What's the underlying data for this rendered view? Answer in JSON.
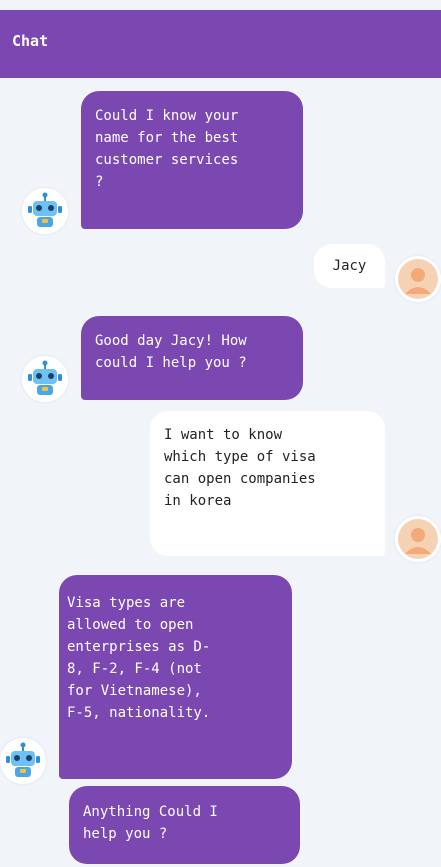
{
  "header": {
    "title": "Chat"
  },
  "messages": [
    {
      "from": "bot",
      "text": "Could I know your\nname for the best\ncustomer services\n?",
      "avatar": "robot-icon"
    },
    {
      "from": "user",
      "text": "Jacy",
      "avatar": "user-avatar-icon"
    },
    {
      "from": "bot",
      "text": "Good day Jacy! How\ncould I help you ?",
      "avatar": "robot-icon"
    },
    {
      "from": "user",
      "text": "I want to know\nwhich type of visa\ncan open companies\nin korea",
      "avatar": "user-avatar-icon"
    },
    {
      "from": "bot",
      "text": "Visa types are\nallowed to open\nenterprises as D-\n8, F-2, F-4 (not\nfor Vietnamese),\nF-5, nationality.",
      "avatar": "robot-icon"
    },
    {
      "from": "bot",
      "text": "Anything Could I\nhelp you ?"
    }
  ],
  "colors": {
    "accent": "#7b48b2",
    "background": "#f1f4f9",
    "user_bubble": "#ffffff"
  }
}
